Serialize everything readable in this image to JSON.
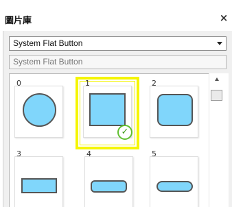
{
  "window": {
    "title": "圖片庫",
    "close_symbol": "×"
  },
  "style_select": {
    "selected": "System Flat Button"
  },
  "name_field": {
    "value": "System Flat Button"
  },
  "gallery": {
    "items": [
      {
        "label": "0",
        "shape": "circle"
      },
      {
        "label": "1",
        "shape": "square",
        "selected": true
      },
      {
        "label": "2",
        "shape": "rounded-square"
      },
      {
        "label": "3",
        "shape": "rectangle"
      },
      {
        "label": "4",
        "shape": "rounded-rectangle"
      },
      {
        "label": "5",
        "shape": "pill"
      }
    ],
    "check_symbol": "✓"
  },
  "colors": {
    "shape_fill": "#80d6fb",
    "selection_highlight": "#f5f500",
    "check_green": "#5fbf2f"
  }
}
